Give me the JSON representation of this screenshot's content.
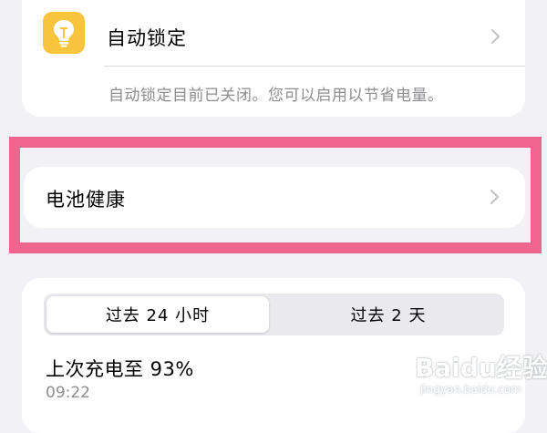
{
  "auto_lock": {
    "label": "自动锁定",
    "footnote": "自动锁定目前已关闭。您可以启用以节省电量。",
    "icon": "lightbulb-icon",
    "icon_color": "#f7c53c"
  },
  "battery_health": {
    "label": "电池健康"
  },
  "highlight_color": "#f0658f",
  "usage": {
    "tabs": [
      {
        "label": "过去 24 小时",
        "selected": true
      },
      {
        "label": "过去 2 天",
        "selected": false
      }
    ],
    "last_charge": "上次充电至 93%",
    "last_charge_time": "09:22"
  },
  "watermark": {
    "text": "Baidu经验",
    "subtext": "jingyan.baidu.com"
  }
}
